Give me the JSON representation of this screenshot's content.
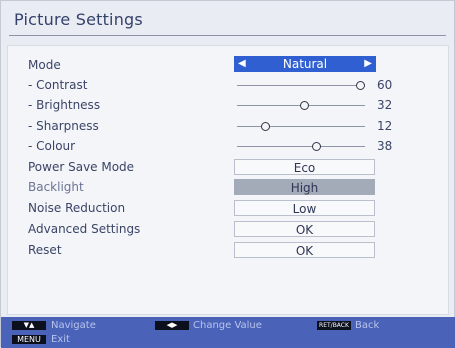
{
  "title": "Picture Settings",
  "rows": {
    "mode": {
      "label": "Mode",
      "value": "Natural"
    },
    "contrast": {
      "label": "- Contrast",
      "value": "60",
      "level": 60
    },
    "brightness": {
      "label": "- Brightness",
      "value": "32",
      "level": 32
    },
    "sharpness": {
      "label": "- Sharpness",
      "value": "12",
      "level": 12
    },
    "colour": {
      "label": "- Colour",
      "value": "38",
      "level": 38
    },
    "power_save": {
      "label": "Power Save Mode",
      "value": "Eco"
    },
    "backlight": {
      "label": "Backlight",
      "value": "High"
    },
    "noise_reduction": {
      "label": "Noise Reduction",
      "value": "Low"
    },
    "advanced": {
      "label": "Advanced Settings",
      "value": "OK"
    },
    "reset": {
      "label": "Reset",
      "value": "OK"
    }
  },
  "footer": {
    "navigate": "Navigate",
    "change_value": "Change Value",
    "back_key": "RET/BACK",
    "back": "Back",
    "menu_key": "MENU",
    "exit": "Exit"
  },
  "colors": {
    "accent": "#2f5fd0",
    "footer_bg": "#4a62b8",
    "selected_row": "#a3abb8"
  },
  "icons": {
    "mode_prev": "triangle-left-icon",
    "mode_next": "triangle-right-icon"
  }
}
